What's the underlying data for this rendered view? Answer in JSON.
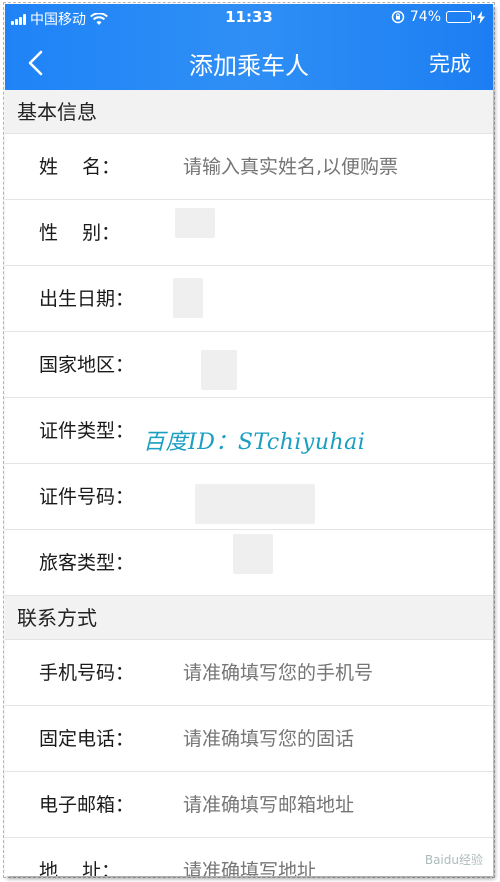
{
  "status_bar": {
    "carrier": "中国移动",
    "time": "11:33",
    "battery_percent": "74%",
    "battery_level": 0.74
  },
  "nav": {
    "title": "添加乘车人",
    "done_label": "完成"
  },
  "sections": {
    "basic": {
      "title": "基本信息",
      "fields": {
        "name": {
          "label": "姓    名：",
          "placeholder": "请输入真实姓名,以便购票"
        },
        "gender": {
          "label": "性    别："
        },
        "birthdate": {
          "label": "出生日期："
        },
        "region": {
          "label": "国家地区："
        },
        "id_type": {
          "label": "证件类型："
        },
        "id_number": {
          "label": "证件号码："
        },
        "passenger_type": {
          "label": "旅客类型："
        }
      }
    },
    "contact": {
      "title": "联系方式",
      "fields": {
        "mobile": {
          "label": "手机号码：",
          "placeholder": "请准确填写您的手机号"
        },
        "landline": {
          "label": "固定电话：",
          "placeholder": "请准确填写您的固话"
        },
        "email": {
          "label": "电子邮箱：",
          "placeholder": "请准确填写邮箱地址"
        },
        "address": {
          "label": "地    址：",
          "placeholder": "请准确填写地址"
        }
      }
    }
  },
  "watermark": "百度ID：STchiyuhai",
  "corner_logo": "Baidu经验"
}
